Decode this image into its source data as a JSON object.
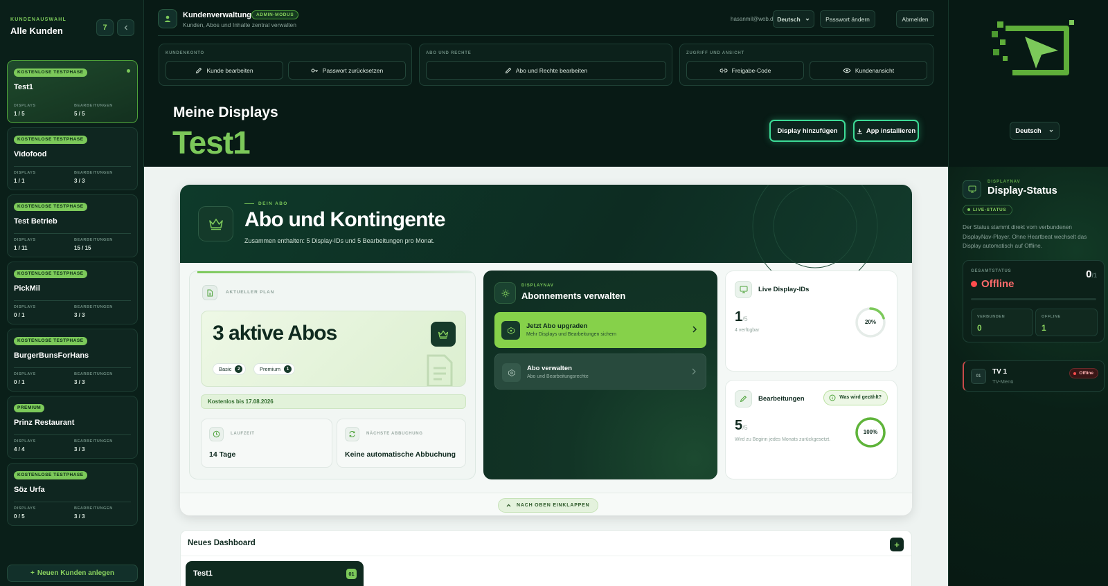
{
  "sidebar": {
    "kicker": "KUNDENAUSWAHL",
    "title": "Alle Kunden",
    "count": "7",
    "customers": [
      {
        "badge": "KOSTENLOSE TESTPHASE",
        "name": "Test1",
        "displays": "1 / 5",
        "edits": "5 / 5"
      },
      {
        "badge": "KOSTENLOSE TESTPHASE",
        "name": "Vidofood",
        "displays": "1 / 1",
        "edits": "3 / 3"
      },
      {
        "badge": "KOSTENLOSE TESTPHASE",
        "name": "Test Betrieb",
        "displays": "1 / 11",
        "edits": "15 / 15"
      },
      {
        "badge": "KOSTENLOSE TESTPHASE",
        "name": "PickMil",
        "displays": "0 / 1",
        "edits": "3 / 3"
      },
      {
        "badge": "KOSTENLOSE TESTPHASE",
        "name": "BurgerBunsForHans",
        "displays": "0 / 1",
        "edits": "3 / 3"
      },
      {
        "badge": "PREMIUM",
        "name": "Prinz Restaurant",
        "displays": "4 / 4",
        "edits": "3 / 3"
      },
      {
        "badge": "KOSTENLOSE TESTPHASE",
        "name": "Söz Urfa",
        "displays": "0 / 5",
        "edits": "3 / 3"
      }
    ],
    "displays_label": "DISPLAYS",
    "edits_label": "BEARBEITUNGEN",
    "add_label": "Neuen Kunden anlegen"
  },
  "header": {
    "title": "Kundenverwaltung",
    "admin_badge": "ADMIN-MODUS",
    "subtitle": "Kunden, Abos und Inhalte zentral verwalten",
    "email": "hasanmil@web.de",
    "language": "Deutsch",
    "password_change": "Passwort ändern",
    "logout": "Abmelden",
    "groups": {
      "account": {
        "label": "KUNDENKONTO",
        "edit": "Kunde bearbeiten",
        "reset": "Passwort zurücksetzen"
      },
      "rights": {
        "label": "ABO UND RECHTE",
        "edit": "Abo und Rechte bearbeiten"
      },
      "access": {
        "label": "ZUGRIFF UND ANSICHT",
        "share": "Freigabe-Code",
        "view": "Kundenansicht"
      }
    },
    "displays_heading": "Meine Displays",
    "customer_name": "Test1",
    "add_display": "Display hinzufügen",
    "install_app": "App installieren",
    "right_language": "Deutsch"
  },
  "abo": {
    "kicker": "DEIN ABO",
    "title": "Abo und Kontingente",
    "subtitle": "Zusammen enthalten: 5 Display-IDs und 5 Bearbeitungen pro Monat.",
    "plan": {
      "label": "AKTUELLER PLAN",
      "headline": "3 aktive Abos",
      "chips": [
        {
          "name": "Basic",
          "count": "2"
        },
        {
          "name": "Premium",
          "count": "1"
        }
      ],
      "free_until": "Kostenlos bis 17.08.2026",
      "runtime_label": "LAUFZEIT",
      "runtime_value": "14 Tage",
      "next_label": "NÄCHSTE ABBUCHUNG",
      "next_value": "Keine automatische Abbuchung"
    },
    "manage": {
      "kicker": "DISPLAYNAV",
      "title": "Abonnements verwalten",
      "upgrade_title": "Jetzt Abo upgraden",
      "upgrade_sub": "Mehr Displays und Bearbeitungen sichern",
      "manage_title": "Abo verwalten",
      "manage_sub": "Abo und Bearbeitungsrechte"
    },
    "live": {
      "title": "Live Display-IDs",
      "value": "1",
      "max": "/5",
      "note": "4 verfügbar",
      "percent_label": "20%",
      "percent": 0.2
    },
    "edits": {
      "title": "Bearbeitungen",
      "help": "Was wird gezählt?",
      "value": "5",
      "max": "/5",
      "note": "Wird zu Beginn jedes Monats zurückgesetzt.",
      "percent_label": "100%",
      "percent": 1.0
    },
    "collapse_label": "NACH OBEN EINKLAPPEN"
  },
  "dashboard": {
    "title": "Neues Dashboard",
    "card_name": "Test1",
    "card_count": "01"
  },
  "status": {
    "kicker": "DISPLAYNAV",
    "title": "Display-Status",
    "live": "LIVE-STATUS",
    "description": "Der Status stammt direkt vom verbundenen DisplayNav-Player. Ohne Heartbeat wechselt das Display automatisch auf Offline.",
    "overall_label": "GESAMTSTATUS",
    "overall_value": "Offline",
    "count": "0",
    "count_max": "/1",
    "connected_label": "VERBUNDEN",
    "connected_value": "0",
    "offline_label": "OFFLINE",
    "offline_value": "1",
    "device": {
      "num": "01",
      "name": "TV 1",
      "menu": "TV-Menü",
      "state": "Offline"
    }
  },
  "colors": {
    "accent": "#7cc95a",
    "dark": "#081a15",
    "offline": "#ff4d4d",
    "glow": "#3ddc97"
  }
}
